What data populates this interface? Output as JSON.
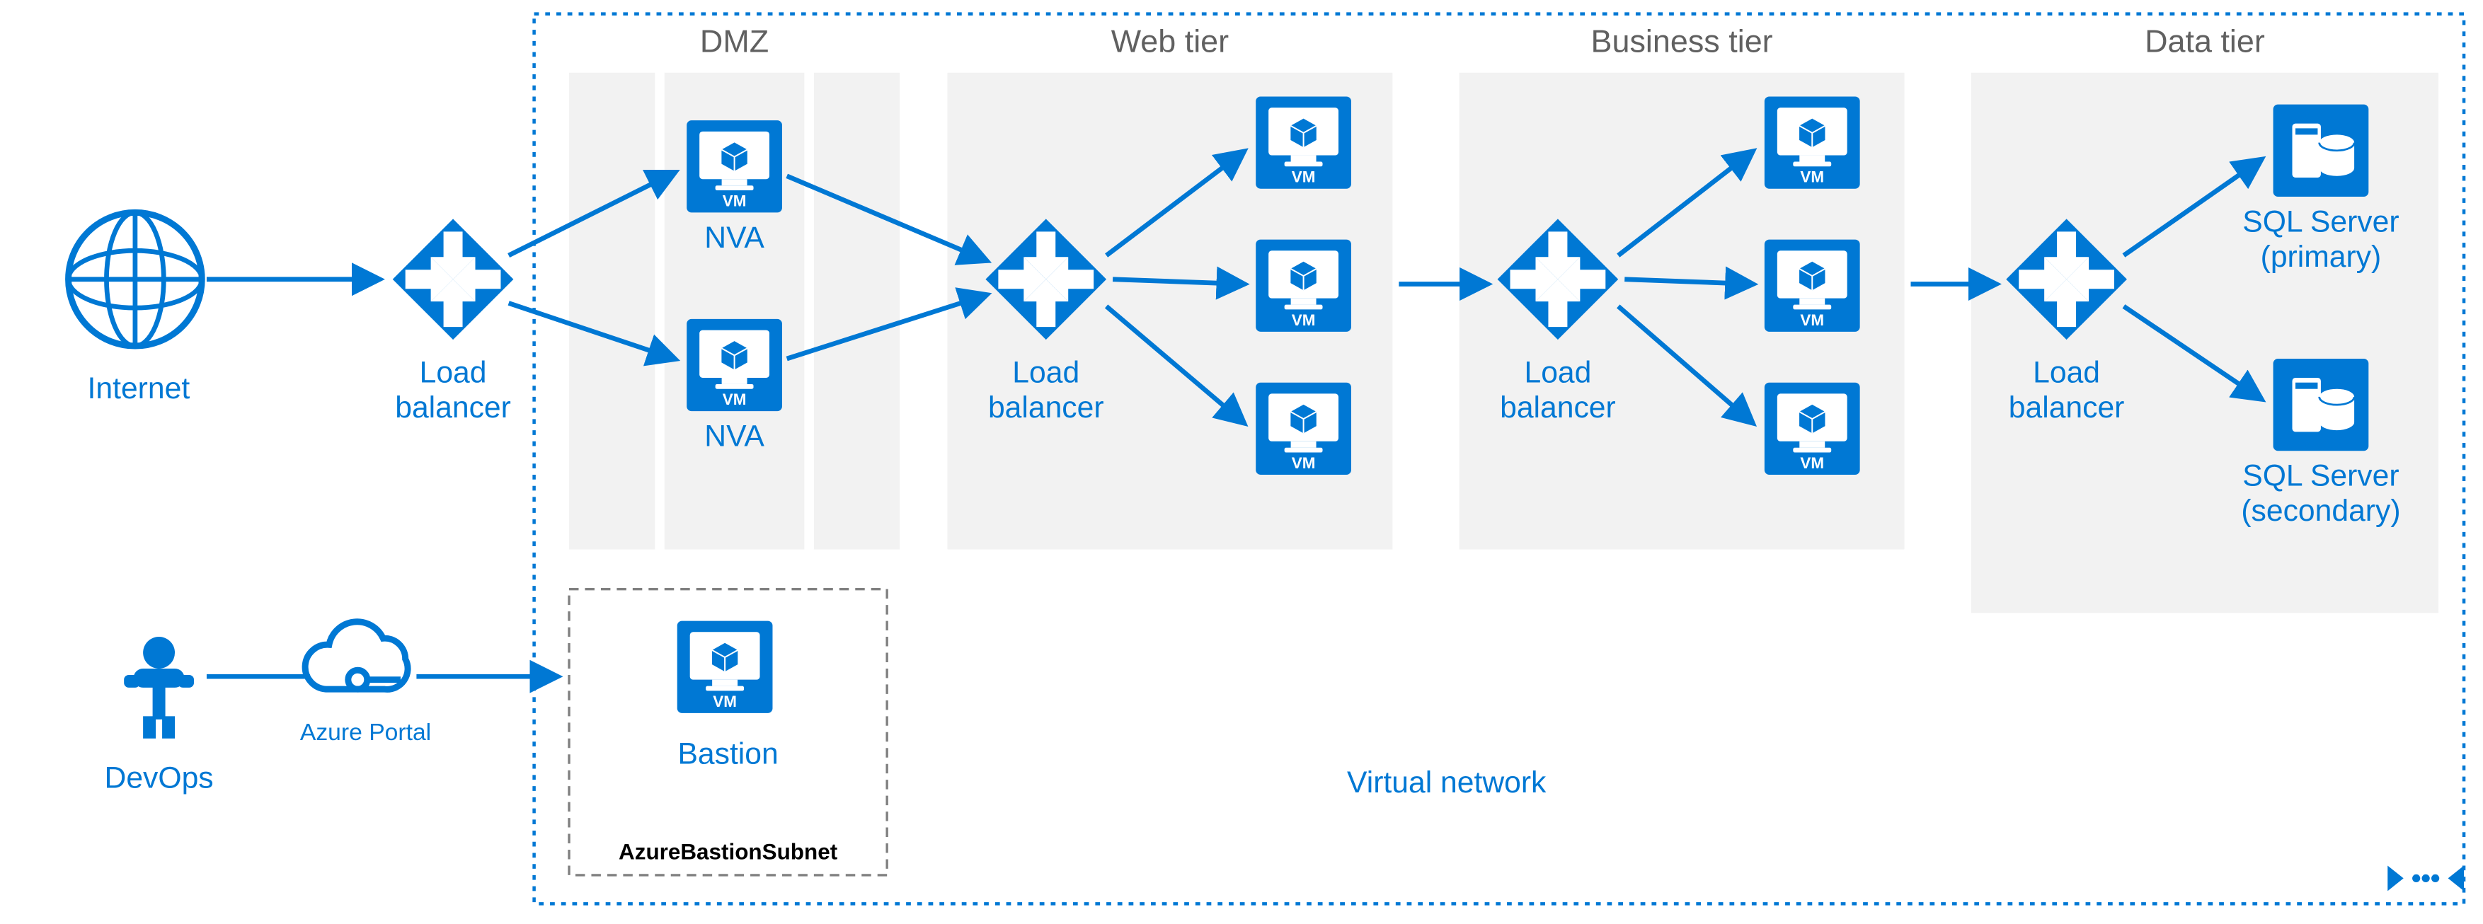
{
  "external": {
    "internet": "Internet",
    "devops": "DevOps",
    "azure_portal": "Azure Portal"
  },
  "load_balancers": {
    "public": "Load balancer",
    "web": "Load balancer",
    "business": "Load balancer",
    "data": "Load balancer"
  },
  "tiers": {
    "dmz": {
      "header": "DMZ",
      "nva1": "NVA",
      "nva2": "NVA"
    },
    "web": {
      "header": "Web tier"
    },
    "business": {
      "header": "Business tier"
    },
    "data": {
      "header": "Data tier",
      "sql_primary_line1": "SQL Server",
      "sql_primary_line2": "(primary)",
      "sql_secondary_line1": "SQL Server",
      "sql_secondary_line2": "(secondary)"
    }
  },
  "bastion": {
    "label": "Bastion",
    "subnet": "AzureBastionSubnet"
  },
  "vnet_label": "Virtual network",
  "vm_badge": "VM"
}
